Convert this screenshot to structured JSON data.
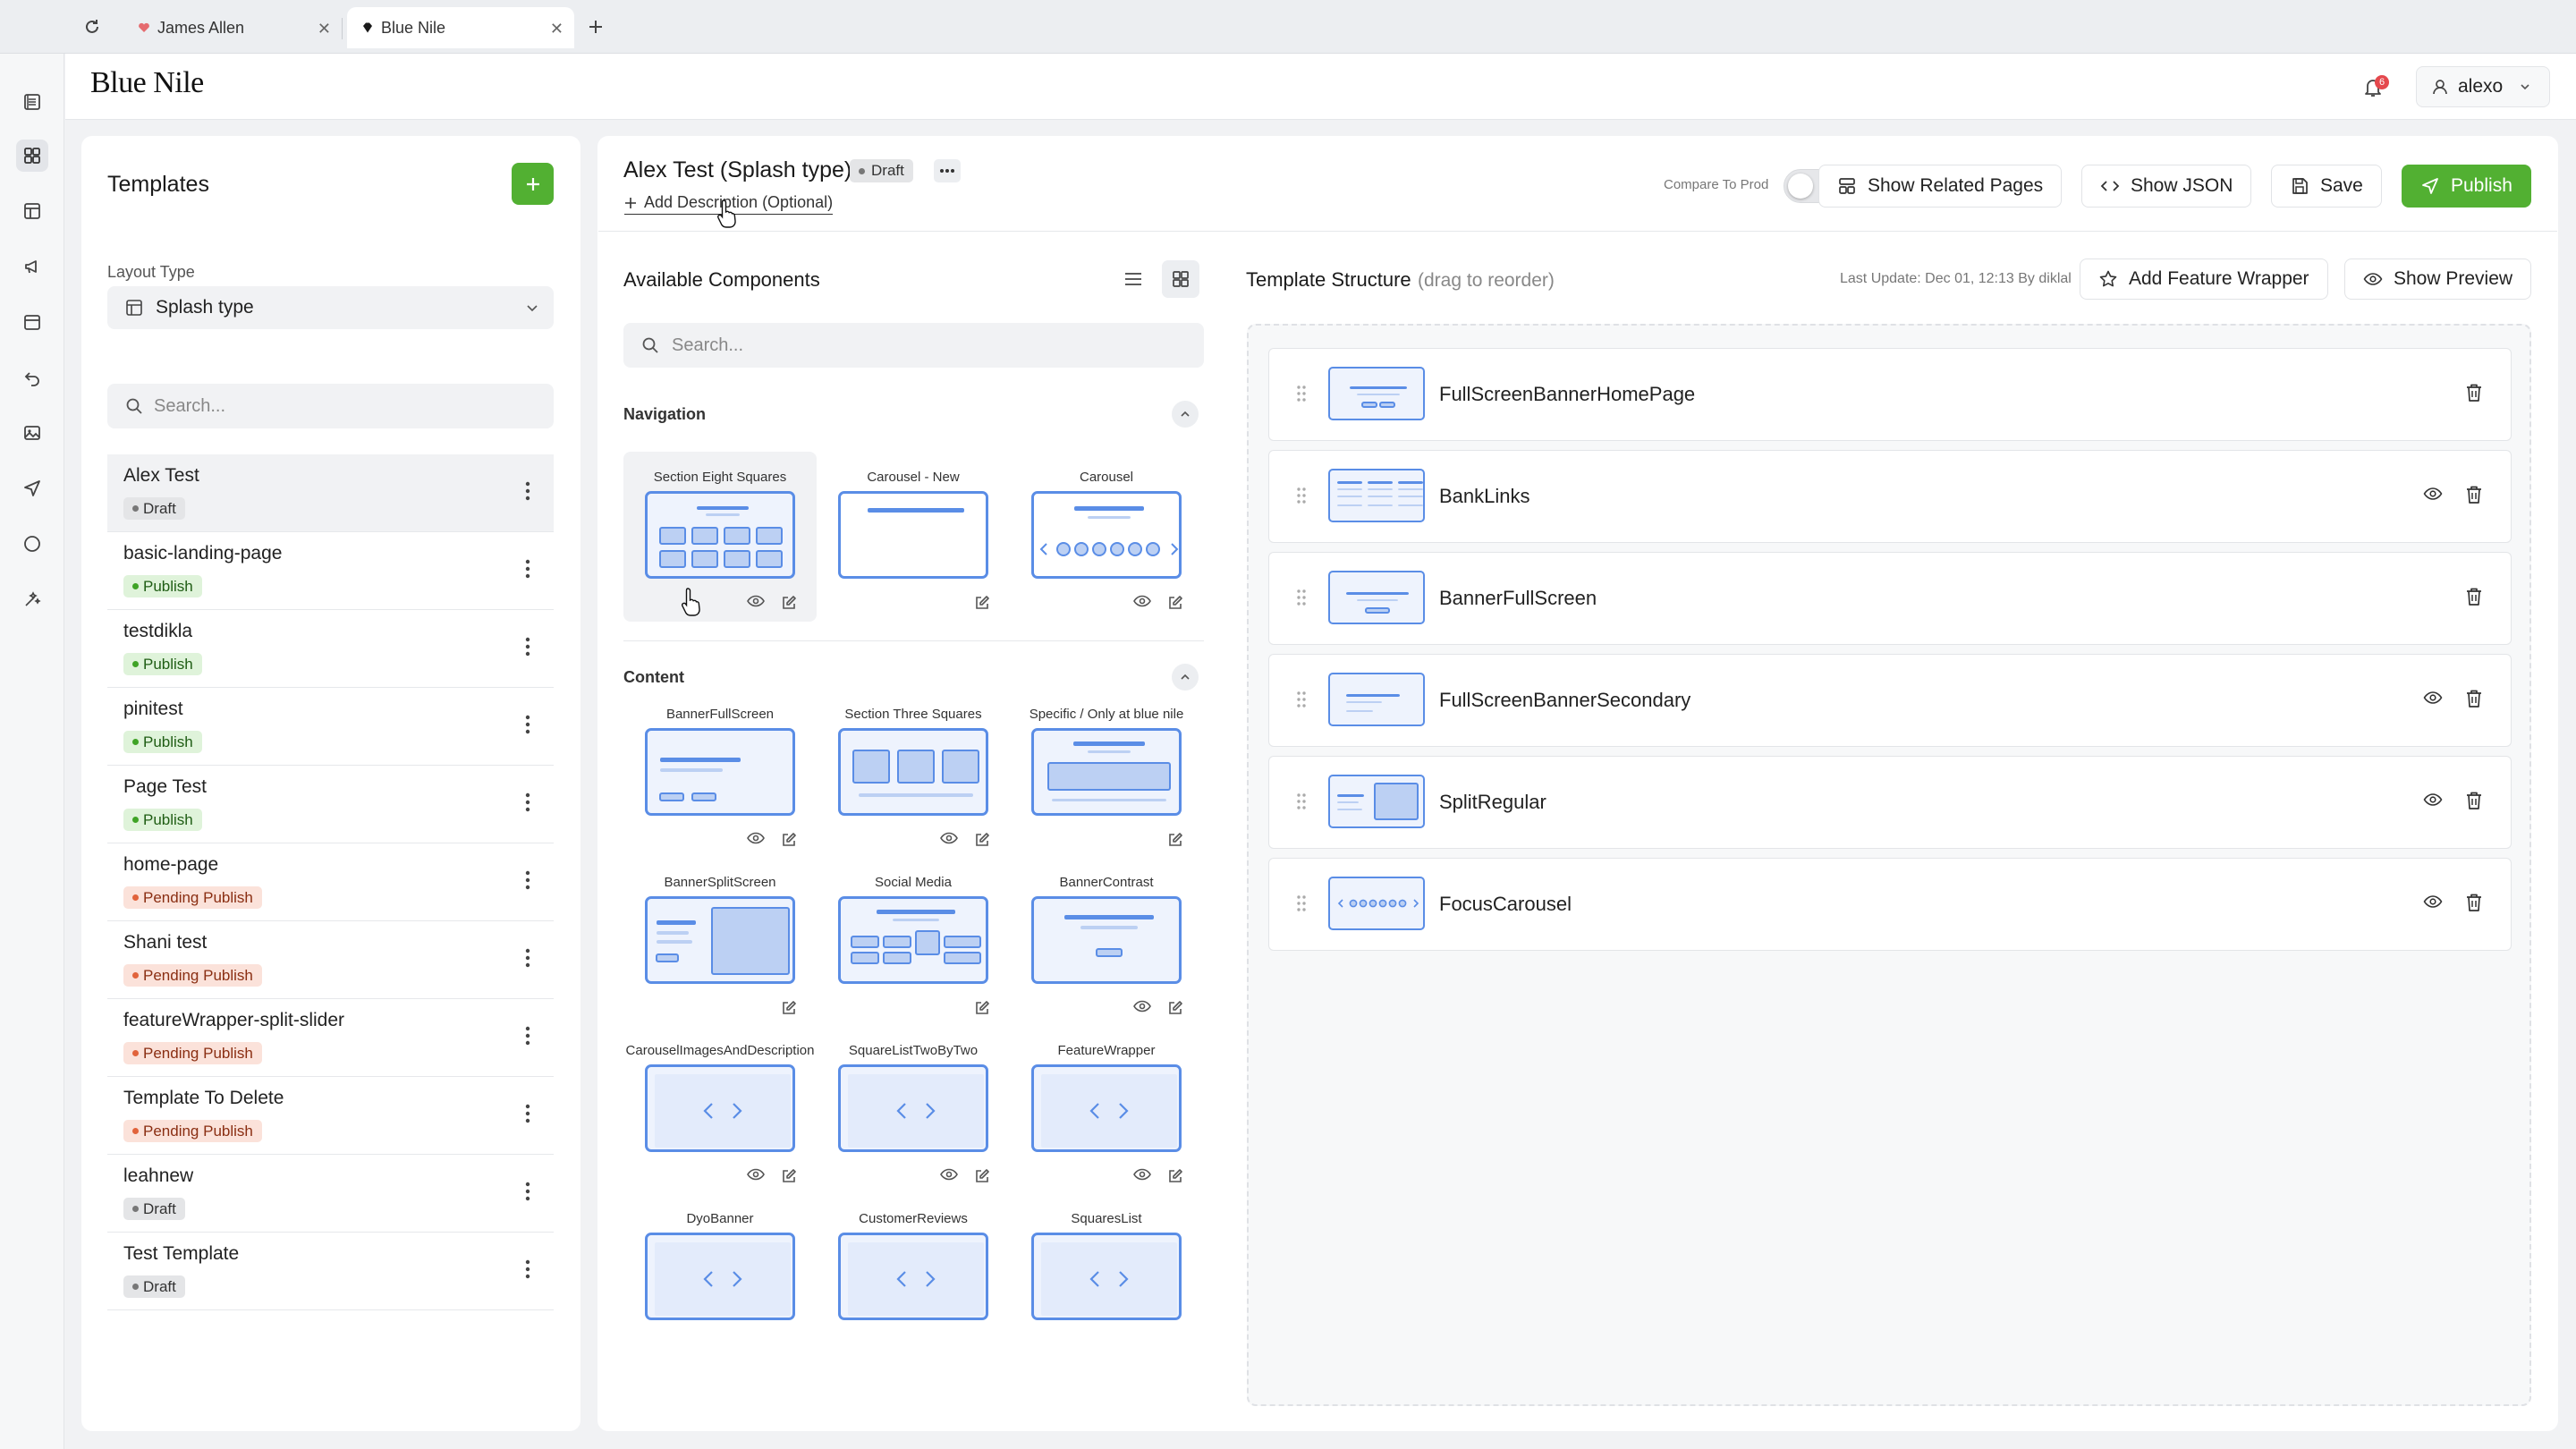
{
  "browser": {
    "tabs": [
      {
        "title": "James Allen",
        "active": false
      },
      {
        "title": "Blue Nile",
        "active": true
      }
    ]
  },
  "app": {
    "brand": "Blue Nile",
    "notifications_count": "6",
    "user": "alexo"
  },
  "sidebar_icons": [
    "pages-icon",
    "templates-icon",
    "layout-icon",
    "megaphone-icon",
    "calendar-icon",
    "undo-icon",
    "image-icon",
    "send-icon",
    "circle-icon",
    "sparkle-icon"
  ],
  "templates_panel": {
    "title": "Templates",
    "layout_type_label": "Layout Type",
    "layout_type_value": "Splash type",
    "search_placeholder": "Search...",
    "items": [
      {
        "name": "Alex Test",
        "status": "Draft",
        "selected": true
      },
      {
        "name": "basic-landing-page",
        "status": "Publish"
      },
      {
        "name": "testdikla",
        "status": "Publish"
      },
      {
        "name": "pinitest",
        "status": "Publish"
      },
      {
        "name": "Page Test",
        "status": "Publish"
      },
      {
        "name": "home-page",
        "status": "Pending Publish"
      },
      {
        "name": "Shani test",
        "status": "Pending Publish"
      },
      {
        "name": "featureWrapper-split-slider",
        "status": "Pending Publish"
      },
      {
        "name": "Template To Delete",
        "status": "Pending Publish"
      },
      {
        "name": "leahnew",
        "status": "Draft"
      },
      {
        "name": "Test Template",
        "status": "Draft"
      }
    ]
  },
  "editor": {
    "title": "Alex Test (Splash type)",
    "status": "Draft",
    "add_description": "Add Description (Optional)",
    "compare_label": "Compare To Prod",
    "compare_on": false,
    "buttons": {
      "related": "Show Related Pages",
      "json": "Show JSON",
      "save": "Save",
      "publish": "Publish"
    }
  },
  "components": {
    "title": "Available Components",
    "search_placeholder": "Search...",
    "sections": [
      {
        "title": "Navigation",
        "items": [
          {
            "name": "Section Eight Squares",
            "thumb": "eight-squares",
            "eye": true,
            "edit": true
          },
          {
            "name": "Carousel - New",
            "thumb": "carousel-new",
            "eye": false,
            "edit": true
          },
          {
            "name": "Carousel",
            "thumb": "carousel",
            "eye": true,
            "edit": true
          }
        ]
      },
      {
        "title": "Content",
        "items": [
          {
            "name": "BannerFullScreen",
            "thumb": "banner-full",
            "eye": true,
            "edit": true
          },
          {
            "name": "Section  Three Squares",
            "thumb": "three-squares",
            "eye": true,
            "edit": true
          },
          {
            "name": "Specific / Only at blue nile",
            "thumb": "specific",
            "eye": false,
            "edit": true
          },
          {
            "name": "BannerSplitScreen",
            "thumb": "split",
            "eye": false,
            "edit": true
          },
          {
            "name": "Social Media",
            "thumb": "social",
            "eye": false,
            "edit": true
          },
          {
            "name": "BannerContrast",
            "thumb": "contrast",
            "eye": true,
            "edit": true
          },
          {
            "name": "CarouselImagesAndDescription",
            "thumb": "code",
            "eye": true,
            "edit": true
          },
          {
            "name": "SquareListTwoByTwo",
            "thumb": "code",
            "eye": true,
            "edit": true
          },
          {
            "name": "FeatureWrapper",
            "thumb": "code",
            "eye": true,
            "edit": true
          },
          {
            "name": "DyoBanner",
            "thumb": "code",
            "eye": false,
            "edit": false
          },
          {
            "name": "CustomerReviews",
            "thumb": "code",
            "eye": false,
            "edit": false
          },
          {
            "name": "SquaresList",
            "thumb": "code",
            "eye": false,
            "edit": false
          }
        ]
      }
    ]
  },
  "structure": {
    "title": "Template Structure",
    "hint": "(drag to reorder)",
    "last_update": "Last Update: Dec 01, 12:13 By diklal",
    "add_feature_wrapper": "Add Feature Wrapper",
    "show_preview": "Show Preview",
    "rows": [
      {
        "name": "FullScreenBannerHomePage",
        "thumb": "s-home",
        "eye": false
      },
      {
        "name": "BankLinks",
        "thumb": "s-links",
        "eye": true
      },
      {
        "name": "BannerFullScreen",
        "thumb": "s-banner",
        "eye": false
      },
      {
        "name": "FullScreenBannerSecondary",
        "thumb": "s-secondary",
        "eye": true
      },
      {
        "name": "SplitRegular",
        "thumb": "s-split",
        "eye": true
      },
      {
        "name": "FocusCarousel",
        "thumb": "s-carousel",
        "eye": true
      }
    ]
  },
  "colors": {
    "accent_green": "#52b032",
    "thumb_blue": "#5a8de6",
    "draft_bg": "#e4e5e7",
    "publish_bg": "#dff3da",
    "pending_bg": "#fbe2da"
  }
}
